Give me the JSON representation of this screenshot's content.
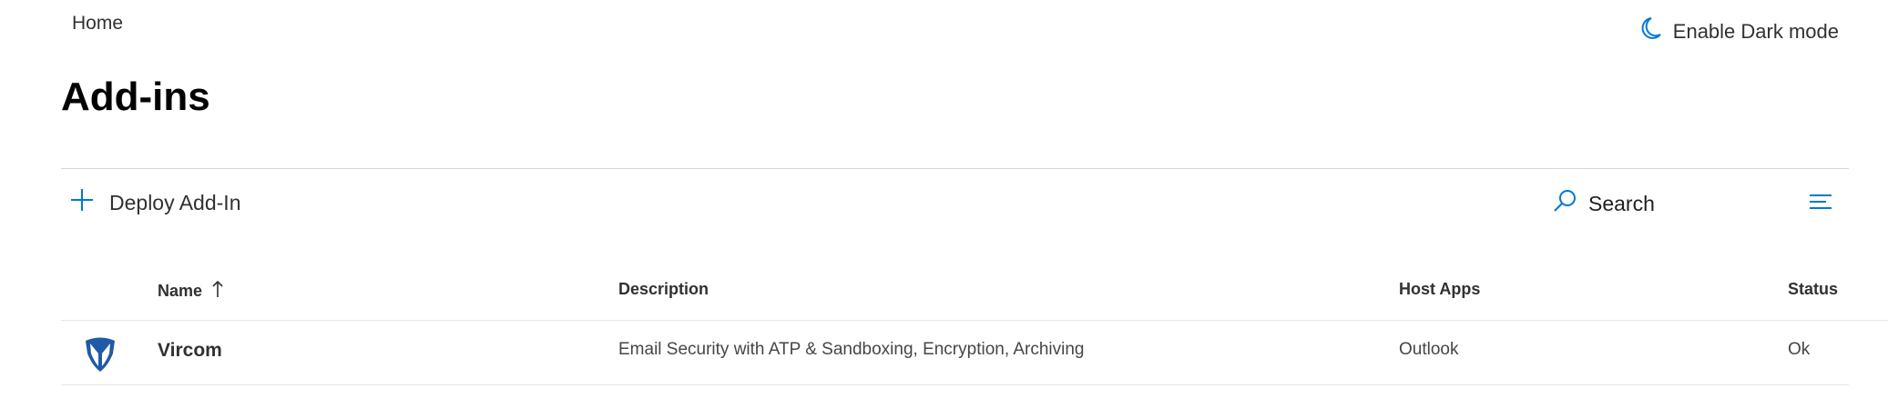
{
  "breadcrumb": {
    "home": "Home"
  },
  "header": {
    "dark_mode_label": "Enable Dark mode",
    "title": "Add-ins"
  },
  "toolbar": {
    "deploy_label": "Deploy Add-In",
    "search_label": "Search"
  },
  "icons": {
    "dark_mode": "moon-icon",
    "deploy": "plus-icon",
    "search": "search-icon",
    "filter": "filter-lines-icon",
    "sort": "arrow-up-icon",
    "vircom_logo": "vircom-logo"
  },
  "colors": {
    "accent": "#0078d4",
    "logo": "#1f5aa6",
    "text": "#323130",
    "divider": "#d6d6d6"
  },
  "table": {
    "columns": {
      "name": "Name",
      "description": "Description",
      "host_apps": "Host Apps",
      "status": "Status"
    },
    "sort": {
      "column": "Name",
      "direction": "ascending"
    },
    "rows": [
      {
        "name": "Vircom",
        "description": "Email Security with ATP & Sandboxing, Encryption, Archiving",
        "host_apps": "Outlook",
        "status": "Ok"
      }
    ]
  }
}
